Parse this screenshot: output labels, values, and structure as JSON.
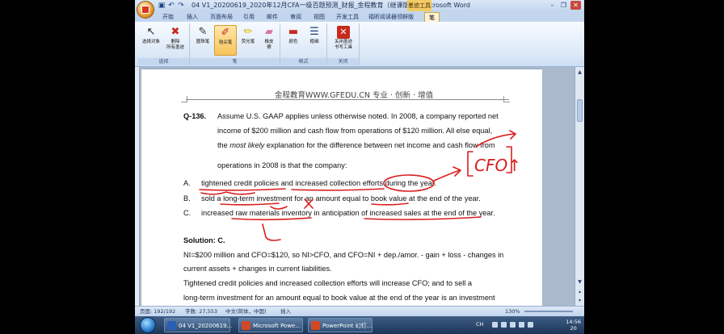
{
  "window": {
    "title": "04 V1_20200619_2020年12月CFA一级百题预测_财报_金程教育（继课版） - Microsoft Word",
    "context_tab_label": "墨迹工具",
    "controls": {
      "minimize": "–",
      "restore": "❐",
      "close": "✕"
    }
  },
  "tabs": [
    "开始",
    "插入",
    "页面布局",
    "引用",
    "邮件",
    "审阅",
    "视图",
    "开发工具",
    "福昕阅读器领鲜版",
    "笔"
  ],
  "active_tab": "笔",
  "ribbon": {
    "groups": [
      {
        "label": "选择",
        "buttons": [
          {
            "label": "选择对象",
            "icon": "cursor-icon"
          },
          {
            "label": "删除\n所有墨迹",
            "icon": "eraser-x-icon"
          }
        ]
      },
      {
        "label": "笔",
        "buttons": [
          {
            "label": "圆珠笔",
            "icon": "ballpoint-pen-icon"
          },
          {
            "label": "毡尖笔",
            "icon": "felt-tip-pen-icon",
            "active": true
          },
          {
            "label": "荧光笔",
            "icon": "highlighter-icon"
          },
          {
            "label": "橡皮\n擦",
            "icon": "eraser-icon"
          }
        ]
      },
      {
        "label": "格式",
        "buttons": [
          {
            "label": "颜色",
            "icon": "color-icon"
          },
          {
            "label": "粗细",
            "icon": "weight-icon"
          }
        ]
      },
      {
        "label": "关闭",
        "buttons": [
          {
            "label": "关闭墨迹\n书写工具",
            "icon": "close-ink-icon"
          }
        ]
      }
    ]
  },
  "document": {
    "header": "金程教育WWW.GFEDU.CN 专业 · 创新 · 增值",
    "question_number": "Q-136.",
    "question_lines": [
      "Assume U.S. GAAP applies unless otherwise noted. In 2008, a company reported net",
      "income of $200 million and cash flow from operations of $120 million. All else equal,",
      "the most likely explanation for the difference between net income and cash flow from",
      "operations in 2008 is that the company:"
    ],
    "options": [
      {
        "letter": "A.",
        "text": "tightened credit policies and increased collection efforts during the year."
      },
      {
        "letter": "B.",
        "text": "sold a long-term investment for an amount equal to book value at the end of the year."
      },
      {
        "letter": "C.",
        "text": "increased raw materials inventory in anticipation of increased sales at the end of the year."
      }
    ],
    "solution_label": "Solution: C.",
    "solution_lines": [
      "NI=$200 million and CFO=$120, so NI>CFO, and CFO=NI + dep./amor. - gain + loss - changes in",
      "current assets + changes in current liabilities.",
      "Tightened credit policies and increased collection efforts will increase CFO; and to sell a",
      "long-term investment for an amount equal to book value at the end of the year is an investment"
    ],
    "annotations": {
      "handwritten_note": "CFO↑",
      "ink_color": "#d91f1f"
    }
  },
  "statusbar": {
    "page": "页面: 192/192",
    "words": "字数: 27,553",
    "language": "中文(简体，中国)",
    "insert_mode": "插入",
    "zoom": "130%"
  },
  "taskbar": {
    "tasks": [
      {
        "label": "04 V1_20200619...",
        "icon_color": "#2b5fb4"
      },
      {
        "label": "Microsoft Powe...",
        "icon_color": "#d24726"
      },
      {
        "label": "PowerPoint 幻灯...",
        "icon_color": "#d24726"
      }
    ],
    "tray_language": "CH",
    "clock_time": "14:56",
    "clock_date": "20"
  },
  "colors": {
    "accent": "#f3ca66",
    "ink": "#d91f1f",
    "ribbon": "#dde9f7"
  }
}
